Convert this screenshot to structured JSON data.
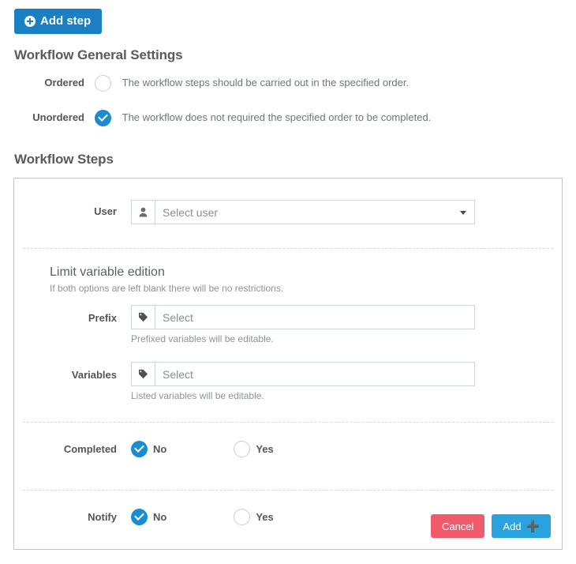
{
  "toolbar": {
    "add_step_label": "Add step",
    "add_step_icon": "plus-circle-icon"
  },
  "general_settings": {
    "title": "Workflow General Settings",
    "options": [
      {
        "label": "Ordered",
        "selected": false,
        "description": "The workflow steps should be carried out in the specified order."
      },
      {
        "label": "Unordered",
        "selected": true,
        "description": "The workflow does not required the specified order to be completed."
      }
    ]
  },
  "steps_section": {
    "title": "Workflow Steps"
  },
  "step_form": {
    "user": {
      "label": "User",
      "icon": "user-icon",
      "placeholder": "Select user",
      "value": "Select user"
    },
    "limit": {
      "title": "Limit variable edition",
      "subtitle": "If both options are left blank there will be no restrictions.",
      "prefix": {
        "label": "Prefix",
        "icon": "tag-icon",
        "placeholder": "Select",
        "value": "Select",
        "help": "Prefixed variables will be editable."
      },
      "variables": {
        "label": "Variables",
        "icon": "tag-icon",
        "placeholder": "Select",
        "value": "Select",
        "help": "Listed variables will be editable."
      }
    },
    "completed": {
      "label": "Completed",
      "options": [
        {
          "label": "No",
          "selected": true
        },
        {
          "label": "Yes",
          "selected": false
        }
      ]
    },
    "notify": {
      "label": "Notify",
      "options": [
        {
          "label": "No",
          "selected": true
        },
        {
          "label": "Yes",
          "selected": false
        }
      ]
    },
    "actions": {
      "cancel_label": "Cancel",
      "add_label": "Add",
      "add_icon": "plus-icon"
    }
  },
  "colors": {
    "primary_button": "#1b7fc4",
    "accent_blue": "#1b8cd0",
    "add_button": "#29a3dd",
    "cancel_button": "#ef5b6a",
    "panel_border": "#c3c3c3",
    "input_border": "#ccd5dc"
  }
}
